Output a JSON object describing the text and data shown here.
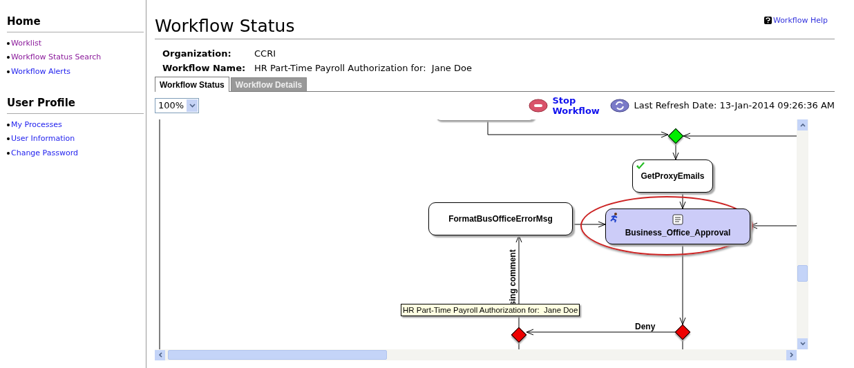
{
  "sidebar": {
    "sections": [
      {
        "title": "Home",
        "links": [
          {
            "label": "Worklist",
            "visited": true
          },
          {
            "label": "Workflow Status Search",
            "visited": true
          },
          {
            "label": "Workflow Alerts",
            "visited": false
          }
        ]
      },
      {
        "title": "User Profile",
        "links": [
          {
            "label": "My Processes",
            "visited": false
          },
          {
            "label": "User Information",
            "visited": false
          },
          {
            "label": "Change Password",
            "visited": false
          }
        ]
      }
    ]
  },
  "page": {
    "title": "Workflow Status",
    "help_link": "Workflow Help"
  },
  "info": [
    {
      "label": "Organization:",
      "value": "CCRI"
    },
    {
      "label": "Workflow Name:",
      "value": "HR Part-Time Payroll Authorization for:  Jane Doe"
    }
  ],
  "tabs": [
    {
      "label": "Workflow Status",
      "selected": true
    },
    {
      "label": "Workflow Details",
      "selected": false
    }
  ],
  "toolbar": {
    "zoom": "100%",
    "stop_button": "Stop Workflow",
    "last_refresh": "Last Refresh Date: 13-Jan-2014 09:26:36 AM"
  },
  "diagram": {
    "nodes": [
      {
        "label": "GetProxyEmails",
        "kind": "completed",
        "highlighted": false
      },
      {
        "label": "FormatBusOfficeErrorMsg",
        "kind": "plain",
        "highlighted": false
      },
      {
        "label": "Business_Office_Approval",
        "kind": "active",
        "highlighted": true
      }
    ],
    "gateways": [
      {
        "color": "#00ee00"
      },
      {
        "color": "#ee0000"
      },
      {
        "color": "#ee0000"
      }
    ],
    "edge_labels": [
      "sing comment",
      "Deny"
    ],
    "tooltip": "HR Part-Time Payroll Authorization for:  Jane Doe"
  }
}
